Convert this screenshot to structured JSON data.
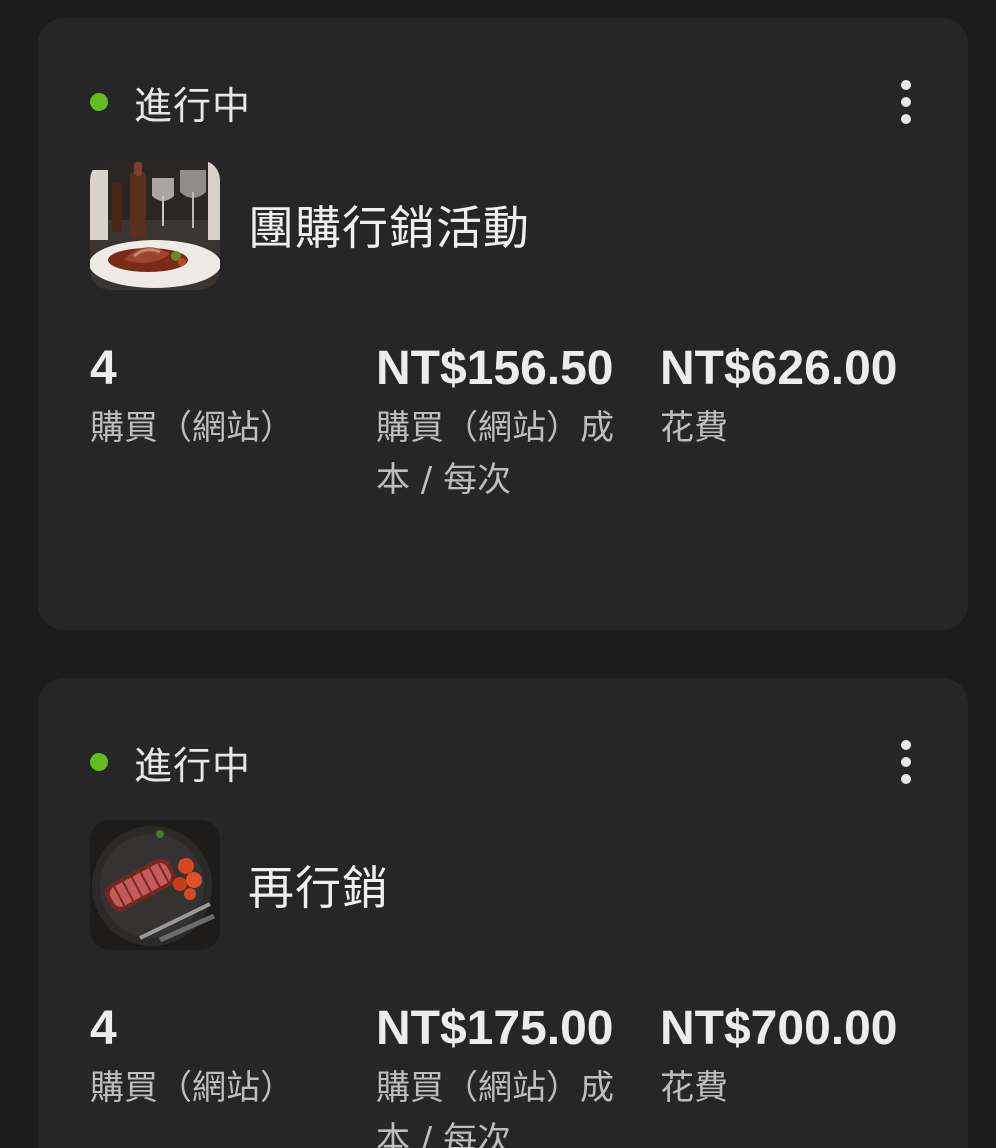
{
  "campaigns": [
    {
      "status": "進行中",
      "status_color": "#5fbf1f",
      "name": "團購行銷活動",
      "thumbnail_icon": "steak-dinner-image",
      "metrics": [
        {
          "value": "4",
          "label": "購買（網站）"
        },
        {
          "value": "NT$156.50",
          "label": "購買（網站）成本 / 每次"
        },
        {
          "value": "NT$626.00",
          "label": "花費"
        }
      ]
    },
    {
      "status": "進行中",
      "status_color": "#5fbf1f",
      "name": "再行銷",
      "thumbnail_icon": "sliced-steak-image",
      "metrics": [
        {
          "value": "4",
          "label": "購買（網站）"
        },
        {
          "value": "NT$175.00",
          "label": "購買（網站）成本 / 每次"
        },
        {
          "value": "NT$700.00",
          "label": "花費"
        }
      ]
    }
  ]
}
